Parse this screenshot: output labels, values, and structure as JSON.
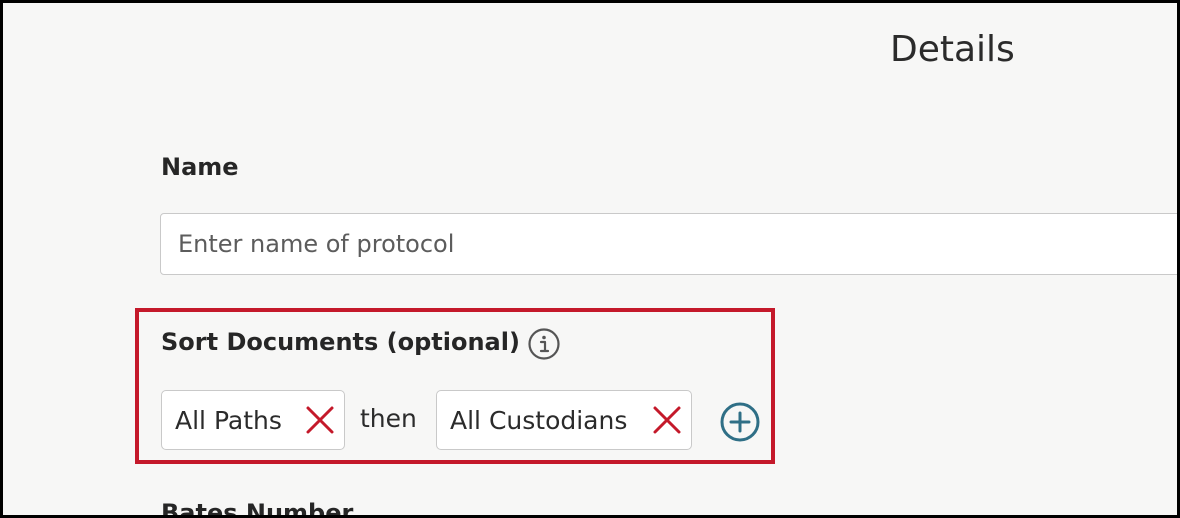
{
  "header": {
    "title": "Details"
  },
  "form": {
    "name": {
      "label": "Name",
      "value": "",
      "placeholder": "Enter name of protocol"
    },
    "sort_documents": {
      "label": "Sort Documents (optional)",
      "info_icon": "info-circle-icon",
      "chips": [
        {
          "label": "All Paths",
          "remove_icon": "close-icon"
        },
        {
          "label": "All Custodians",
          "remove_icon": "close-icon"
        }
      ],
      "joiner": "then",
      "add_icon": "plus-circle-icon"
    },
    "bates_number": {
      "label": "Bates Number"
    }
  },
  "colors": {
    "highlight": "#c4192a",
    "remove_x": "#c4192a",
    "add_icon": "#2f6f86",
    "background": "#f7f7f6"
  }
}
